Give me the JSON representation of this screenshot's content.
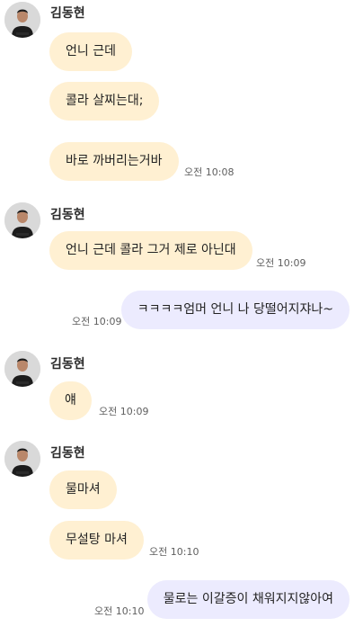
{
  "messages": {
    "group1": {
      "sender": "김동현",
      "bubbles": [
        "언니 근데",
        "콜라 살찌는대;",
        "바로 까버리는거바"
      ],
      "time": "오전 10:08"
    },
    "group2": {
      "sender": "김동현",
      "bubbles": [
        "언니 근데 콜라 그거 제로 아닌대"
      ],
      "time": "오전 10:09"
    },
    "mine1": {
      "text": "ㅋㅋㅋㅋ엄머 언니 나 당떨어지쟈나~",
      "time": "오전 10:09"
    },
    "group3": {
      "sender": "김동현",
      "bubbles": [
        "얘"
      ],
      "time": "오전 10:09"
    },
    "group4": {
      "sender": "김동현",
      "bubbles": [
        "물마셔",
        "무설탕 마셔"
      ],
      "time": "오전 10:10"
    },
    "mine2": {
      "text": "물로는 이갈증이 채워지지않아여",
      "time": "오전 10:10"
    }
  },
  "colors": {
    "incoming_bubble": "#fff0d2",
    "outgoing_bubble": "#ecebfe",
    "timestamp": "#5f5f5f"
  },
  "icons": {
    "avatar": "profile-avatar-icon"
  }
}
